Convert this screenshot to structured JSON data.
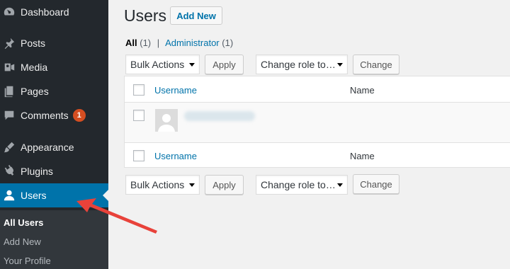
{
  "sidebar": {
    "items": [
      {
        "label": "Dashboard",
        "icon": "dashboard-icon"
      },
      {
        "label": "Posts",
        "icon": "pin-icon"
      },
      {
        "label": "Media",
        "icon": "media-icon"
      },
      {
        "label": "Pages",
        "icon": "pages-icon"
      },
      {
        "label": "Comments",
        "icon": "comment-icon",
        "badge": "1"
      },
      {
        "label": "Appearance",
        "icon": "brush-icon"
      },
      {
        "label": "Plugins",
        "icon": "plug-icon"
      },
      {
        "label": "Users",
        "icon": "user-icon",
        "current": true
      }
    ],
    "submenu": [
      "All Users",
      "Add New",
      "Your Profile"
    ]
  },
  "header": {
    "title": "Users",
    "add_new": "Add New"
  },
  "filters": {
    "all_label": "All",
    "all_count": "(1)",
    "separator": "|",
    "admin_label": "Administrator",
    "admin_count": "(1)"
  },
  "actions": {
    "bulk_actions": "Bulk Actions",
    "apply": "Apply",
    "change_role": "Change role to…",
    "change": "Change"
  },
  "table": {
    "columns": [
      "Username",
      "Name"
    ]
  },
  "colors": {
    "sidebar_bg": "#23282d",
    "submenu_bg": "#32373c",
    "accent": "#0073aa",
    "badge": "#d54e21",
    "annotation_arrow": "#e8423a"
  }
}
